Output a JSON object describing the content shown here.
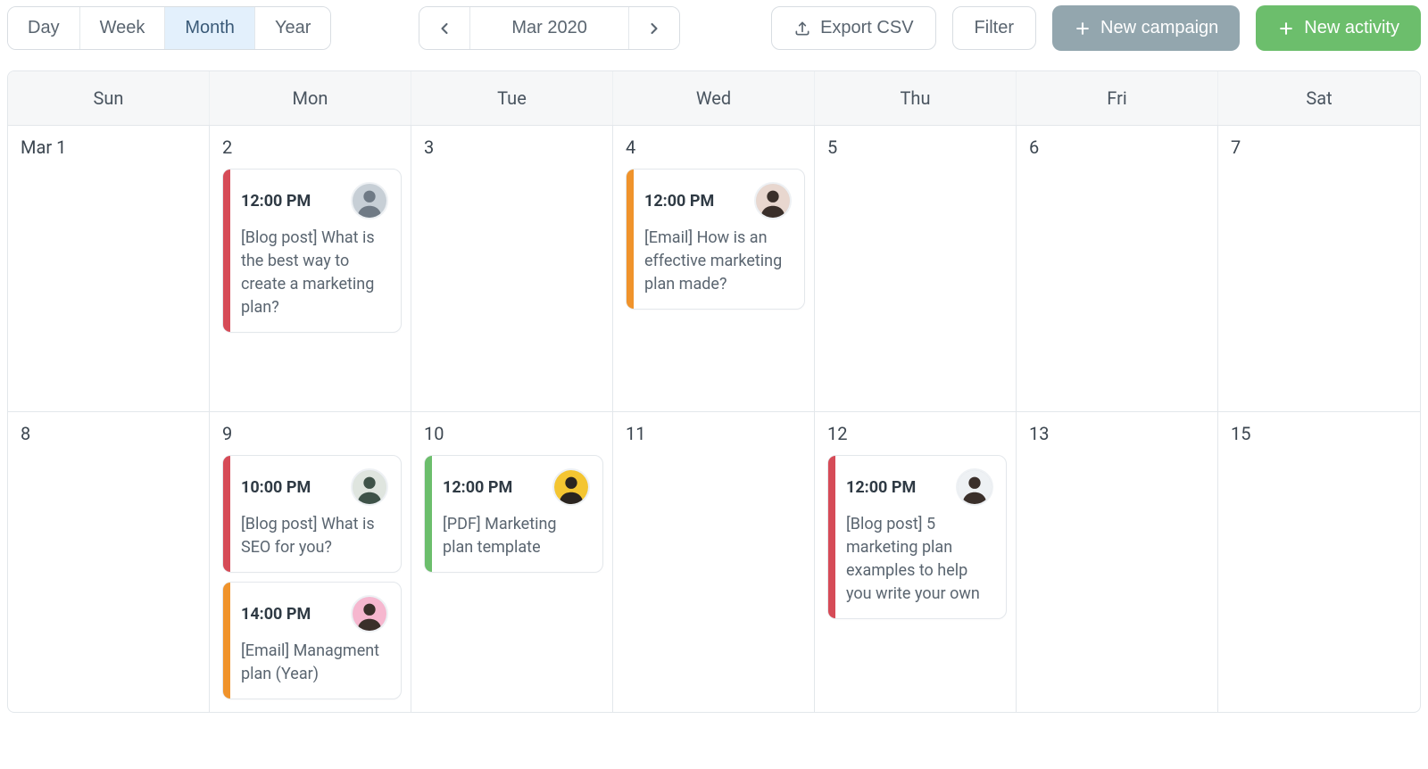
{
  "colors": {
    "red": "#d64b57",
    "orange": "#f0932b",
    "green": "#6cbe6c"
  },
  "toolbar": {
    "views": {
      "day": "Day",
      "week": "Week",
      "month": "Month",
      "year": "Year",
      "active": "month"
    },
    "period_label": "Mar 2020",
    "export_label": "Export CSV",
    "filter_label": "Filter",
    "new_campaign_label": "New campaign",
    "new_activity_label": "New activity"
  },
  "day_headers": [
    "Sun",
    "Mon",
    "Tue",
    "Wed",
    "Thu",
    "Fri",
    "Sat"
  ],
  "weeks": [
    {
      "days": [
        {
          "label": "Mar 1",
          "events": []
        },
        {
          "label": "2",
          "events": [
            {
              "time": "12:00 PM",
              "title": "[Blog post] What is the best way to create a marketing plan?",
              "color": "red",
              "avatar": "a1"
            }
          ]
        },
        {
          "label": "3",
          "events": []
        },
        {
          "label": "4",
          "events": [
            {
              "time": "12:00 PM",
              "title": "[Email] How is an effective marketing plan made?",
              "color": "orange",
              "avatar": "a2"
            }
          ]
        },
        {
          "label": "5",
          "events": []
        },
        {
          "label": "6",
          "events": []
        },
        {
          "label": "7",
          "events": []
        }
      ]
    },
    {
      "days": [
        {
          "label": "8",
          "events": []
        },
        {
          "label": "9",
          "events": [
            {
              "time": "10:00 PM",
              "title": "[Blog post] What is SEO for you?",
              "color": "red",
              "avatar": "a3"
            },
            {
              "time": "14:00 PM",
              "title": "[Email] Managment plan (Year)",
              "color": "orange",
              "avatar": "a4"
            }
          ]
        },
        {
          "label": "10",
          "events": [
            {
              "time": "12:00 PM",
              "title": "[PDF] Marketing plan template",
              "color": "green",
              "avatar": "a5"
            }
          ]
        },
        {
          "label": "11",
          "events": []
        },
        {
          "label": "12",
          "events": [
            {
              "time": "12:00 PM",
              "title": "[Blog post] 5 marketing plan examples to help you write your own",
              "color": "red",
              "avatar": "a6"
            }
          ]
        },
        {
          "label": "13",
          "events": []
        },
        {
          "label": "15",
          "events": []
        }
      ]
    }
  ],
  "avatars": {
    "a1": {
      "bg": "#c7cfd6",
      "fg": "#6f7a85"
    },
    "a2": {
      "bg": "#e8d7cf",
      "fg": "#3a2f2a"
    },
    "a3": {
      "bg": "#dfe5df",
      "fg": "#3e5248"
    },
    "a4": {
      "bg": "#f6b7cf",
      "fg": "#3a2f2a"
    },
    "a5": {
      "bg": "#f4c531",
      "fg": "#2a2420"
    },
    "a6": {
      "bg": "#eef1f4",
      "fg": "#3a2f2a"
    }
  }
}
